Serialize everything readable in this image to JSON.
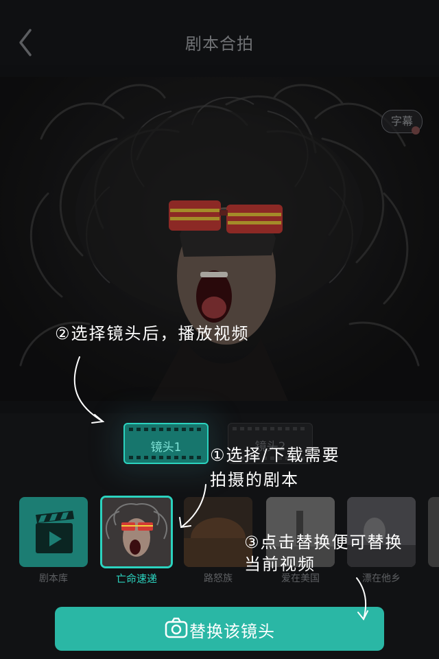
{
  "header": {
    "title": "剧本合拍",
    "back_icon": "chevron-left-icon"
  },
  "video": {
    "subtitle_button": "字幕"
  },
  "shots": [
    {
      "label": "镜头1",
      "selected": true
    },
    {
      "label": "镜头2",
      "selected": false
    }
  ],
  "scripts": [
    {
      "name": "剧本库",
      "icon": "clapperboard-icon",
      "selected": false
    },
    {
      "name": "亡命速递",
      "selected": true
    },
    {
      "name": "路怒族",
      "selected": false
    },
    {
      "name": "爱在美国",
      "selected": false
    },
    {
      "name": "漂在他乡",
      "selected": false
    }
  ],
  "replace_button": {
    "label": "替换该镜头",
    "icon": "camera-icon"
  },
  "annotations": {
    "step2": "②选择镜头后，播放视频",
    "step1_line1": "①选择/下载需要",
    "step1_line2": "拍摄的剧本",
    "step3_line1": "③点击替换便可替换",
    "step3_line2": "当前视频"
  },
  "colors": {
    "accent": "#2bd3bf",
    "button": "#2ab7a5",
    "background": "#0e0f11"
  }
}
